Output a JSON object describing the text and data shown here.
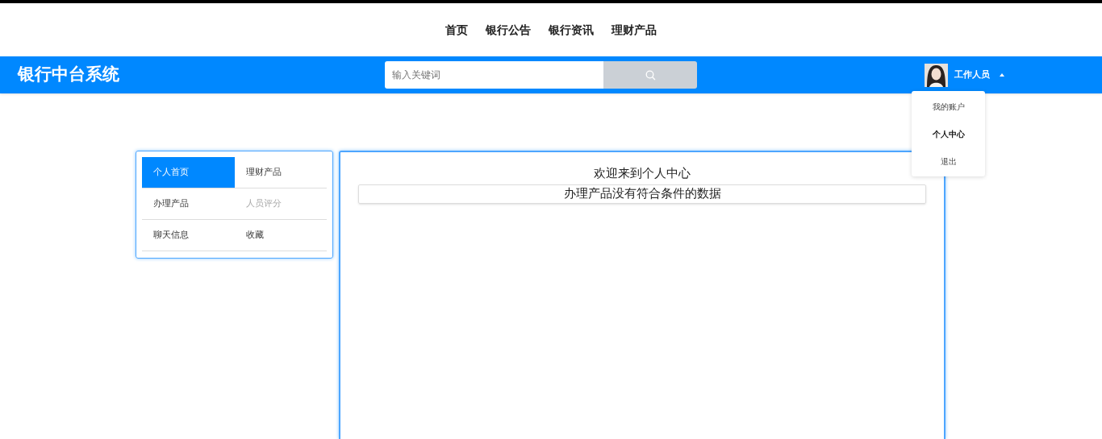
{
  "top_nav": [
    {
      "label": "首页"
    },
    {
      "label": "银行公告"
    },
    {
      "label": "银行资讯"
    },
    {
      "label": "理财产品"
    }
  ],
  "header": {
    "title": "银行中台系统",
    "search": {
      "placeholder": "输入关键词"
    },
    "user": {
      "name": "工作人员",
      "menu_open": true
    }
  },
  "user_menu": [
    {
      "label": "我的账户",
      "selected": false
    },
    {
      "label": "个人中心",
      "selected": true
    },
    {
      "label": "退出",
      "selected": false
    }
  ],
  "side_menu": [
    {
      "label": "个人首页",
      "selected": true,
      "disabled": false
    },
    {
      "label": "理财产品",
      "selected": false,
      "disabled": false
    },
    {
      "label": "办理产品",
      "selected": false,
      "disabled": false
    },
    {
      "label": "人员评分",
      "selected": false,
      "disabled": true
    },
    {
      "label": "聊天信息",
      "selected": false,
      "disabled": false
    },
    {
      "label": "收藏",
      "selected": false,
      "disabled": false
    }
  ],
  "content": {
    "heading": "欢迎来到个人中心",
    "empty_message": "办理产品没有符合条件的数据"
  }
}
